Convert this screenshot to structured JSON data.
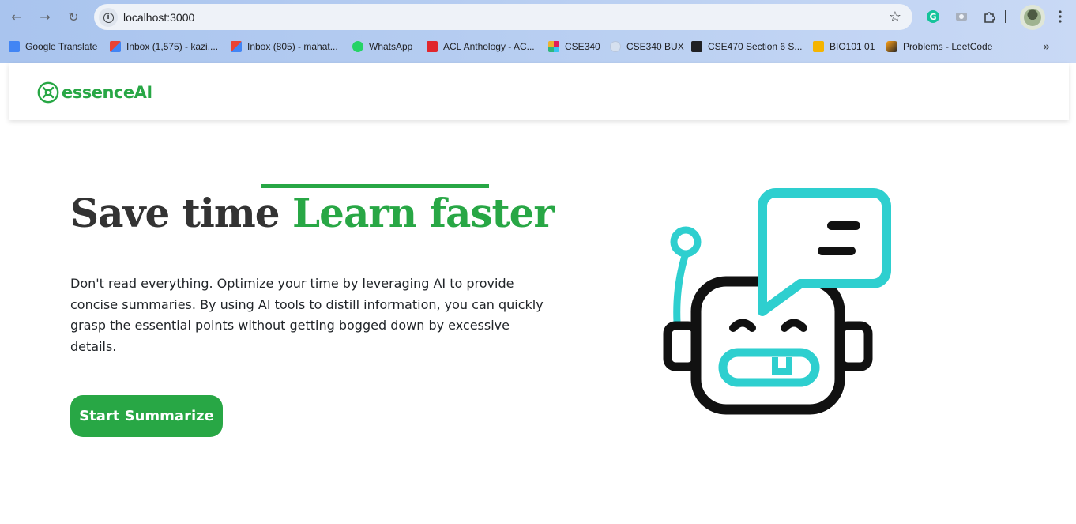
{
  "browser": {
    "url": "localhost:3000",
    "bookmarks": [
      {
        "label": "Google Translate",
        "color": "#4285f4"
      },
      {
        "label": "Inbox (1,575) - kazi....",
        "color": "#ea4335"
      },
      {
        "label": "Inbox (805) - mahat...",
        "color": "#ea4335"
      },
      {
        "label": "WhatsApp",
        "color": "#25d366"
      },
      {
        "label": "ACL Anthology - AC...",
        "color": "#e0262d"
      },
      {
        "label": "CSE340",
        "color": "#e01e5a"
      },
      {
        "label": "CSE340 BUX",
        "color": "#b8c6dc"
      },
      {
        "label": "CSE470 Section 6 S...",
        "color": "#202124"
      },
      {
        "label": "BIO101 01",
        "color": "#f4b400"
      },
      {
        "label": "Problems - LeetCode",
        "color": "#ffa116"
      }
    ]
  },
  "header": {
    "logo_text": "essenceAI",
    "brand_color": "#28a745"
  },
  "hero": {
    "headline_plain": "Save time ",
    "headline_accent": "Learn faster",
    "description": "Don't read everything. Optimize your time by leveraging AI to provide concise summaries. By using AI tools to distill information, you can quickly grasp the essential points without getting bogged down by excessive details.",
    "cta_label": "Start Summarize"
  },
  "illustration": {
    "icon": "robot-chat-icon",
    "accent_color": "#2ecfcf"
  }
}
